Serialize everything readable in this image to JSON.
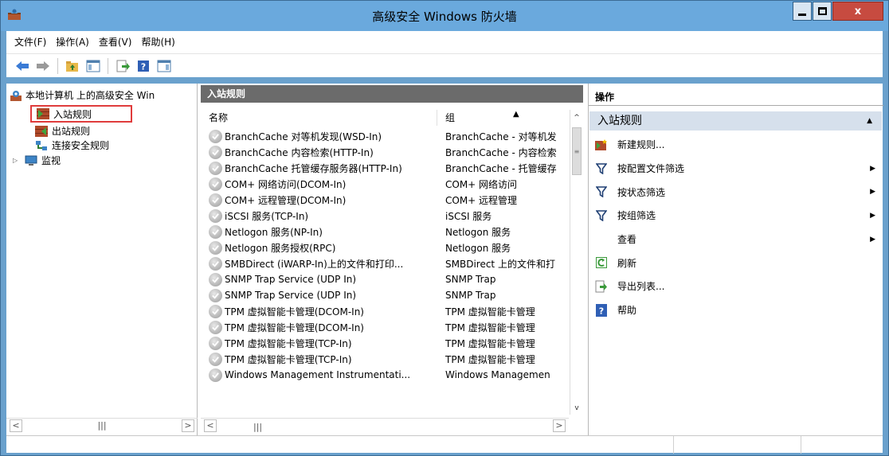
{
  "window": {
    "title": "高级安全 Windows 防火墙",
    "close_label": "x"
  },
  "menu": [
    "文件(F)",
    "操作(A)",
    "查看(V)",
    "帮助(H)"
  ],
  "tree": {
    "root": "本地计算机 上的高级安全 Win",
    "items": [
      "入站规则",
      "出站规则",
      "连接安全规则",
      "监视"
    ],
    "selected": "入站规则"
  },
  "middle": {
    "title": "入站规则",
    "columns": {
      "name": "名称",
      "group": "组"
    },
    "rows": [
      {
        "name": "BranchCache 对等机发现(WSD-In)",
        "group": "BranchCache - 对等机发"
      },
      {
        "name": "BranchCache 内容检索(HTTP-In)",
        "group": "BranchCache - 内容检索"
      },
      {
        "name": "BranchCache 托管缓存服务器(HTTP-In)",
        "group": "BranchCache - 托管缓存"
      },
      {
        "name": "COM+ 网络访问(DCOM-In)",
        "group": "COM+ 网络访问"
      },
      {
        "name": "COM+ 远程管理(DCOM-In)",
        "group": "COM+ 远程管理"
      },
      {
        "name": "iSCSI 服务(TCP-In)",
        "group": "iSCSI 服务"
      },
      {
        "name": "Netlogon 服务(NP-In)",
        "group": "Netlogon 服务"
      },
      {
        "name": "Netlogon 服务授权(RPC)",
        "group": "Netlogon 服务"
      },
      {
        "name": "SMBDirect (iWARP-In)上的文件和打印...",
        "group": "SMBDirect 上的文件和打"
      },
      {
        "name": "SNMP Trap Service (UDP In)",
        "group": "SNMP Trap"
      },
      {
        "name": "SNMP Trap Service (UDP In)",
        "group": "SNMP Trap"
      },
      {
        "name": "TPM 虚拟智能卡管理(DCOM-In)",
        "group": "TPM 虚拟智能卡管理"
      },
      {
        "name": "TPM 虚拟智能卡管理(DCOM-In)",
        "group": "TPM 虚拟智能卡管理"
      },
      {
        "name": "TPM 虚拟智能卡管理(TCP-In)",
        "group": "TPM 虚拟智能卡管理"
      },
      {
        "name": "TPM 虚拟智能卡管理(TCP-In)",
        "group": "TPM 虚拟智能卡管理"
      },
      {
        "name": "Windows Management Instrumentati...",
        "group": "Windows Managemen"
      }
    ]
  },
  "actions": {
    "title": "操作",
    "section": "入站规则",
    "items": [
      {
        "label": "新建规则...",
        "icon": "new-rule-icon",
        "submenu": false
      },
      {
        "label": "按配置文件筛选",
        "icon": "filter-icon",
        "submenu": true
      },
      {
        "label": "按状态筛选",
        "icon": "filter-icon",
        "submenu": true
      },
      {
        "label": "按组筛选",
        "icon": "filter-icon",
        "submenu": true
      },
      {
        "label": "查看",
        "icon": "",
        "submenu": true
      },
      {
        "label": "刷新",
        "icon": "refresh-icon",
        "submenu": false
      },
      {
        "label": "导出列表...",
        "icon": "export-icon",
        "submenu": false
      },
      {
        "label": "帮助",
        "icon": "help-icon",
        "submenu": false
      }
    ]
  },
  "colors": {
    "titlebar": "#6aa9dd",
    "pane_header": "#6b6b6b",
    "section_header": "#d6e0ec",
    "selection_border": "#e03c3c",
    "close_button": "#c74b40"
  }
}
